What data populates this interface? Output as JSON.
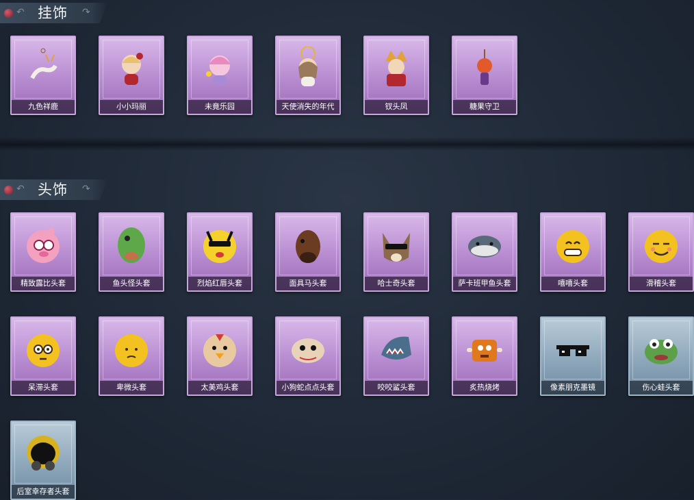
{
  "sections": [
    {
      "title": "挂饰",
      "items": [
        {
          "label": "九色祥鹿",
          "icon": "deer-pendant-icon",
          "frame": "purple"
        },
        {
          "label": "小小玛丽",
          "icon": "doll-girl-pendant-icon",
          "frame": "purple"
        },
        {
          "label": "未竟乐园",
          "icon": "pink-girl-pendant-icon",
          "frame": "purple"
        },
        {
          "label": "天使消失的年代",
          "icon": "angel-doll-pendant-icon",
          "frame": "purple"
        },
        {
          "label": "钗头凤",
          "icon": "phoenix-crown-doll-icon",
          "frame": "purple"
        },
        {
          "label": "糖果守卫",
          "icon": "candy-guard-pendant-icon",
          "frame": "purple"
        }
      ]
    },
    {
      "title": "头饰",
      "items": [
        {
          "label": "精致露比头套",
          "icon": "pink-bear-mask-icon",
          "frame": "purple"
        },
        {
          "label": "鱼头怪头套",
          "icon": "fish-head-mask-icon",
          "frame": "purple"
        },
        {
          "label": "烈焰红唇头套",
          "icon": "yellow-sunglasses-mask-icon",
          "frame": "purple"
        },
        {
          "label": "面具马头套",
          "icon": "horse-mask-icon",
          "frame": "purple"
        },
        {
          "label": "哈士奇头套",
          "icon": "husky-mask-icon",
          "frame": "purple"
        },
        {
          "label": "萨卡班甲鱼头套",
          "icon": "sacabambaspis-mask-icon",
          "frame": "purple"
        },
        {
          "label": "嘻嘻头套",
          "icon": "grin-emoji-mask-icon",
          "frame": "purple"
        },
        {
          "label": "滑稽头套",
          "icon": "funny-emoji-mask-icon",
          "frame": "purple"
        },
        {
          "label": "呆滞头套",
          "icon": "dazed-emoji-mask-icon",
          "frame": "purple"
        },
        {
          "label": "卑微头套",
          "icon": "humble-emoji-mask-icon",
          "frame": "purple"
        },
        {
          "label": "太美鸡头套",
          "icon": "chicken-mask-icon",
          "frame": "purple"
        },
        {
          "label": "小狗蛇点点头套",
          "icon": "snake-mask-icon",
          "frame": "purple"
        },
        {
          "label": "咬咬鲨头套",
          "icon": "shark-mask-icon",
          "frame": "purple"
        },
        {
          "label": "炙热烧烤",
          "icon": "bbq-mask-icon",
          "frame": "purple"
        },
        {
          "label": "像素朋克墨镜",
          "icon": "pixel-sunglasses-icon",
          "frame": "blue"
        },
        {
          "label": "伤心蛙头套",
          "icon": "sad-frog-mask-icon",
          "frame": "blue"
        },
        {
          "label": "后室幸存者头套",
          "icon": "gas-mask-helmet-icon",
          "frame": "blue"
        }
      ]
    }
  ],
  "colors": {
    "purple_frame": "#b78bd0",
    "blue_frame": "#8ea7bb",
    "background": "#1f2937"
  }
}
